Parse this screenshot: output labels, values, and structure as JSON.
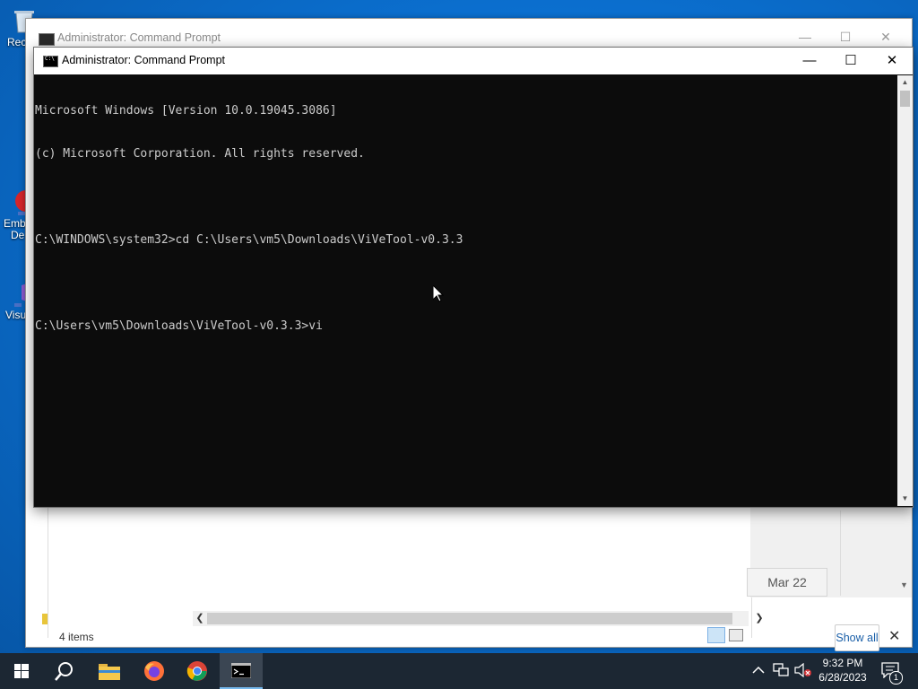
{
  "desktop": {
    "icons": [
      {
        "label": "Rec"
      },
      {
        "label": "Emb"
      },
      {
        "label": "De"
      },
      {
        "label": "Visu"
      }
    ]
  },
  "background_window": {
    "title": "Administrator:  Command Prompt",
    "status_items": "4 items",
    "date_tag": "Mar 22",
    "show_all": "Show all"
  },
  "cmd_window": {
    "title": "Administrator:  Command Prompt",
    "lines": [
      "Microsoft Windows [Version 10.0.19045.3086]",
      "(c) Microsoft Corporation. All rights reserved.",
      "",
      "C:\\WINDOWS\\system32>cd C:\\Users\\vm5\\Downloads\\ViVeTool-v0.3.3",
      "",
      "C:\\Users\\vm5\\Downloads\\ViVeTool-v0.3.3>vi"
    ]
  },
  "taskbar": {
    "time": "9:32 PM",
    "date": "6/28/2023",
    "notifications_count": "1"
  }
}
